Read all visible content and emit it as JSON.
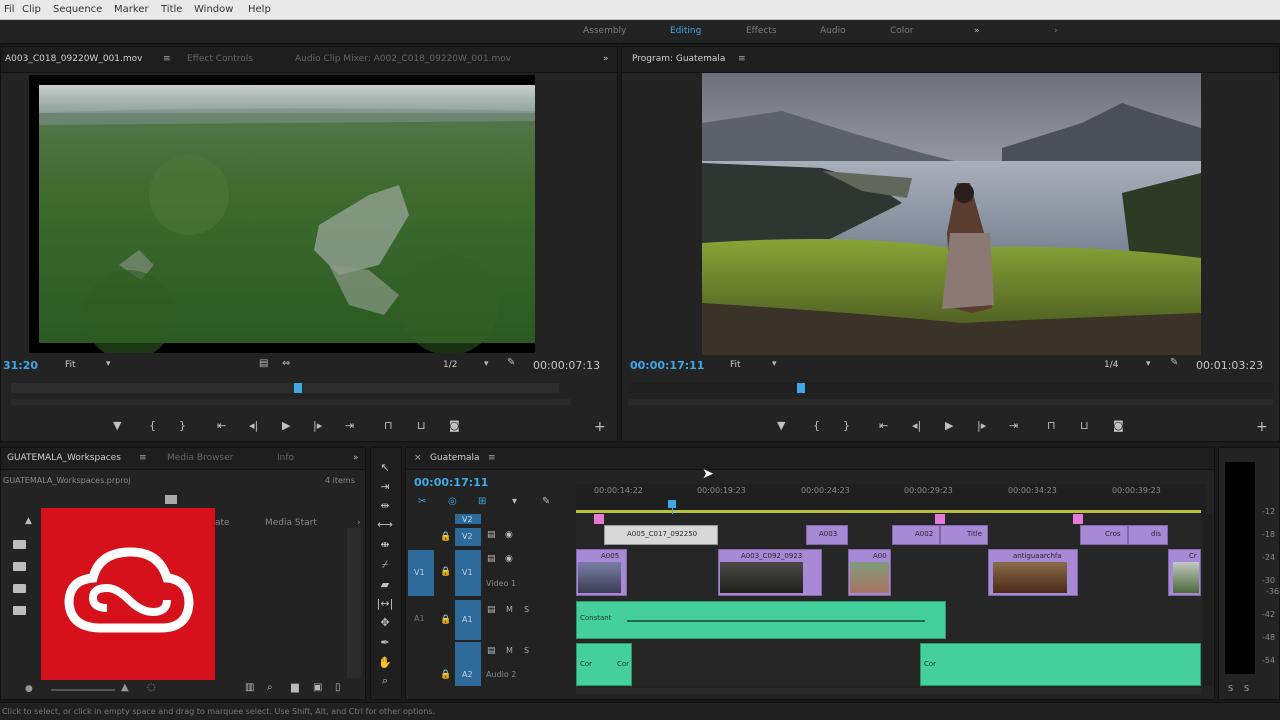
{
  "menu": [
    "Fil",
    "Clip",
    "Sequence",
    "Marker",
    "Title",
    "Window",
    "Help"
  ],
  "workspaces": [
    "Assembly",
    "Editing",
    "Effects",
    "Audio",
    "Color"
  ],
  "source_panel": {
    "tabs": [
      "A003_C018_09220W_001.mov",
      "Effect Controls",
      "Audio Clip Mixer: A002_C018_09220W_001.mov"
    ],
    "timecode_left": "31:20",
    "fit": "Fit",
    "resolution": "1/2",
    "timecode_right": "00:00:07:13"
  },
  "program_panel": {
    "tab": "Program: Guatemala",
    "timecode_left": "00:00:17:11",
    "fit": "Fit",
    "resolution": "1/4",
    "timecode_right": "00:01:03:23"
  },
  "project_panel": {
    "tabs": [
      "GUATEMALA_Workspaces",
      "Media Browser",
      "Info"
    ],
    "file": "GUATEMALA_Workspaces.prproj",
    "items_count": "4 items",
    "col_name": "ate",
    "col_media_start": "Media Start"
  },
  "timeline": {
    "tab": "Guatemala",
    "timecode": "00:00:17:11",
    "ruler": [
      "00:00:14:22",
      "00:00:19:23",
      "00:00:24:23",
      "00:00:29:23",
      "00:00:34:23",
      "00:00:39:23"
    ],
    "tracks": {
      "v2": "V2",
      "v1_src": "V1",
      "v1": "V1",
      "v1_name": "Video 1",
      "a1_src": "A1",
      "a1": "A1",
      "a2": "A2",
      "a2_name": "Audio 2",
      "m": "M",
      "s": "S"
    },
    "v2_clips": [
      "A005_C017_092250",
      "A003",
      "A002",
      "Title",
      "Cros",
      "dis"
    ],
    "v1_clips": [
      "A005",
      "A003_C092_0923",
      "A00",
      "antiguaarchfa",
      "Cr"
    ],
    "a1_clips": [
      "Constant"
    ],
    "a2_clips": [
      "Cor",
      "Cor",
      "Cor"
    ]
  },
  "meters": [
    "-12",
    "-18",
    "-24",
    "-30",
    "-36",
    "-42",
    "-48",
    "-54",
    "S",
    "S"
  ],
  "status": "Click to select, or click in empty space and drag to marquee select. Use Shift, Alt, and Ctrl for other options."
}
